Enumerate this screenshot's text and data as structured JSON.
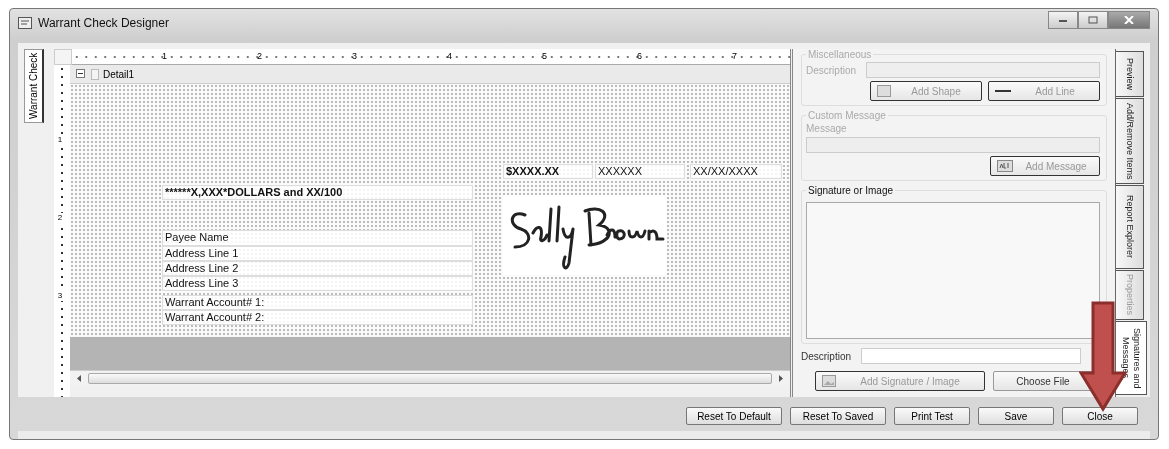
{
  "window": {
    "title": "Warrant Check Designer"
  },
  "left_tabs": [
    {
      "label": "Warrant Check",
      "selected": true
    }
  ],
  "ruler": {
    "top_labels": [
      "1",
      "2",
      "3",
      "4",
      "5",
      "6",
      "7"
    ],
    "side_labels": [
      "1",
      "2",
      "3"
    ]
  },
  "section": {
    "label": "Detail1",
    "expanded": true
  },
  "report_fields": [
    {
      "text": "$XXXX.XX"
    },
    {
      "text": "XXXXXX"
    },
    {
      "text": "XX/XX/XXXX"
    },
    {
      "text": "******X,XXX*DOLLARS and XX/100"
    },
    {
      "text": "Payee Name"
    },
    {
      "text": "Address Line 1"
    },
    {
      "text": "Address Line 2"
    },
    {
      "text": "Address Line 3"
    },
    {
      "text": "Warrant Account# 1:"
    },
    {
      "text": "Warrant Account# 2:"
    }
  ],
  "panel": {
    "misc": {
      "title": "Miscellaneous",
      "disabled": true,
      "description_label": "Description",
      "buttons": [
        "Add Shape",
        "Add Line"
      ]
    },
    "custom_message": {
      "title": "Custom Message",
      "disabled": true,
      "message_label": "Message",
      "button": "Add Message"
    },
    "signature": {
      "title": "Signature or Image",
      "disabled": false,
      "description_label": "Description",
      "buttons": [
        {
          "label": "Add Signature / Image",
          "disabled": true
        },
        {
          "label": "Choose File",
          "disabled": false
        }
      ]
    }
  },
  "right_tabs": [
    {
      "label": "Preview",
      "selected": false,
      "disabled": false
    },
    {
      "label": "Add/Remove Items",
      "selected": false,
      "disabled": false
    },
    {
      "label": "Report Explorer",
      "selected": false,
      "disabled": false
    },
    {
      "label": "Properties",
      "selected": false,
      "disabled": true
    },
    {
      "label": "Signatures and Messages",
      "selected": true,
      "disabled": false
    }
  ],
  "footer_buttons": [
    "Reset To Default",
    "Reset To Saved",
    "Print Test",
    "Save",
    "Close"
  ]
}
